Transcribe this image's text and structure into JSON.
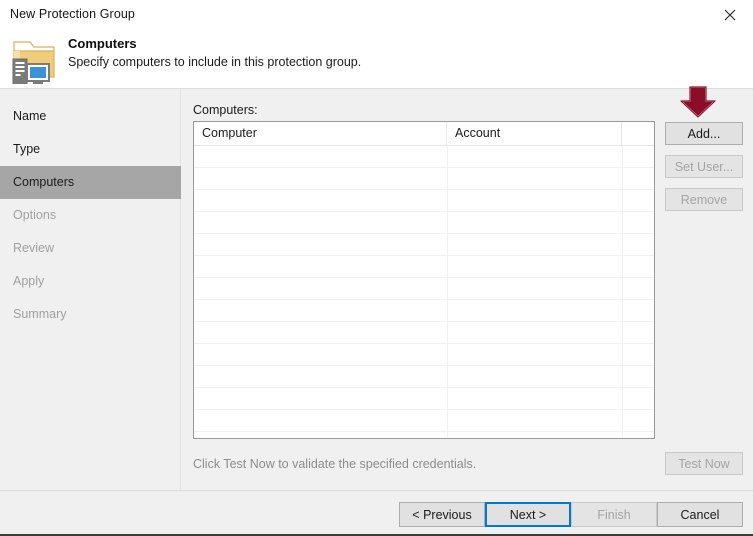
{
  "window": {
    "title": "New Protection Group",
    "close_icon": "close-icon"
  },
  "header": {
    "icon": "computers-folder-icon",
    "title": "Computers",
    "subtitle": "Specify computers to include in this protection group."
  },
  "sidebar": {
    "items": [
      {
        "label": "Name",
        "state": "enabled"
      },
      {
        "label": "Type",
        "state": "enabled"
      },
      {
        "label": "Computers",
        "state": "selected"
      },
      {
        "label": "Options",
        "state": "disabled"
      },
      {
        "label": "Review",
        "state": "disabled"
      },
      {
        "label": "Apply",
        "state": "disabled"
      },
      {
        "label": "Summary",
        "state": "disabled"
      }
    ]
  },
  "main": {
    "list_label": "Computers:",
    "columns": [
      {
        "header": "Computer"
      },
      {
        "header": "Account"
      },
      {
        "header": ""
      }
    ],
    "rows": [],
    "row_count_visible": 14,
    "actions": {
      "add_label": "Add...",
      "set_user_label": "Set User...",
      "remove_label": "Remove",
      "add_enabled": true,
      "set_user_enabled": false,
      "remove_enabled": false
    },
    "hint_text": "Click Test Now to validate the specified credentials.",
    "test_now_label": "Test Now",
    "test_now_enabled": false
  },
  "annotation": {
    "type": "down-arrow",
    "target": "add-button",
    "color": "#8b0d27"
  },
  "footer": {
    "previous_label": "< Previous",
    "next_label": "Next >",
    "finish_label": "Finish",
    "cancel_label": "Cancel",
    "finish_enabled": false,
    "focused_button": "next"
  },
  "colors": {
    "window_bg": "#f0f0f0",
    "panel_bg": "#ffffff",
    "selected_item": "#a6a6a6",
    "focus_border": "#0078d7",
    "disabled_text": "#a4a4a4",
    "annotation": "#8b0d27"
  }
}
